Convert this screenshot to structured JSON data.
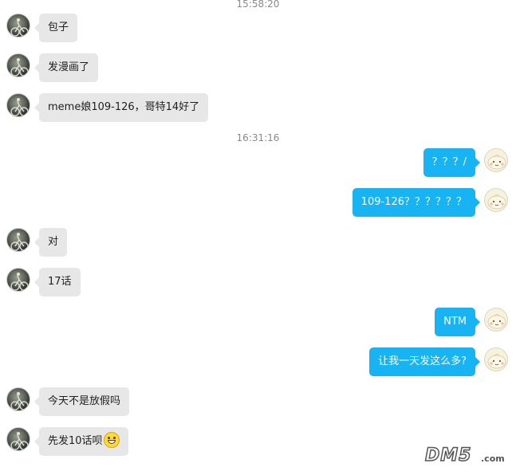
{
  "timestamps": [
    "15:58:20",
    "16:31:16"
  ],
  "messages": [
    {
      "side": "left",
      "text": "包子"
    },
    {
      "side": "left",
      "text": "发漫画了"
    },
    {
      "side": "left",
      "text": "meme娘109-126，哥特14好了"
    },
    {
      "side": "right",
      "text": "？？？/"
    },
    {
      "side": "right",
      "text": "109-126？？？？？？"
    },
    {
      "side": "left",
      "text": "对"
    },
    {
      "side": "left",
      "text": "17话"
    },
    {
      "side": "right",
      "text": "NTM"
    },
    {
      "side": "right",
      "text": "让我一天发这么多?"
    },
    {
      "side": "left",
      "text": "今天不是放假吗"
    },
    {
      "side": "left",
      "text": "先发10话呗",
      "emoji": "grin-emoji"
    }
  ],
  "watermark": {
    "brand": "DM5",
    "suffix": ".com"
  },
  "colors": {
    "left_bubble": "#e7e7e7",
    "right_bubble": "#17b3f2",
    "timestamp": "#8a8a8a"
  },
  "icons": {
    "left_avatar": "cyclist-avatar",
    "right_avatar": "bun-avatar"
  }
}
